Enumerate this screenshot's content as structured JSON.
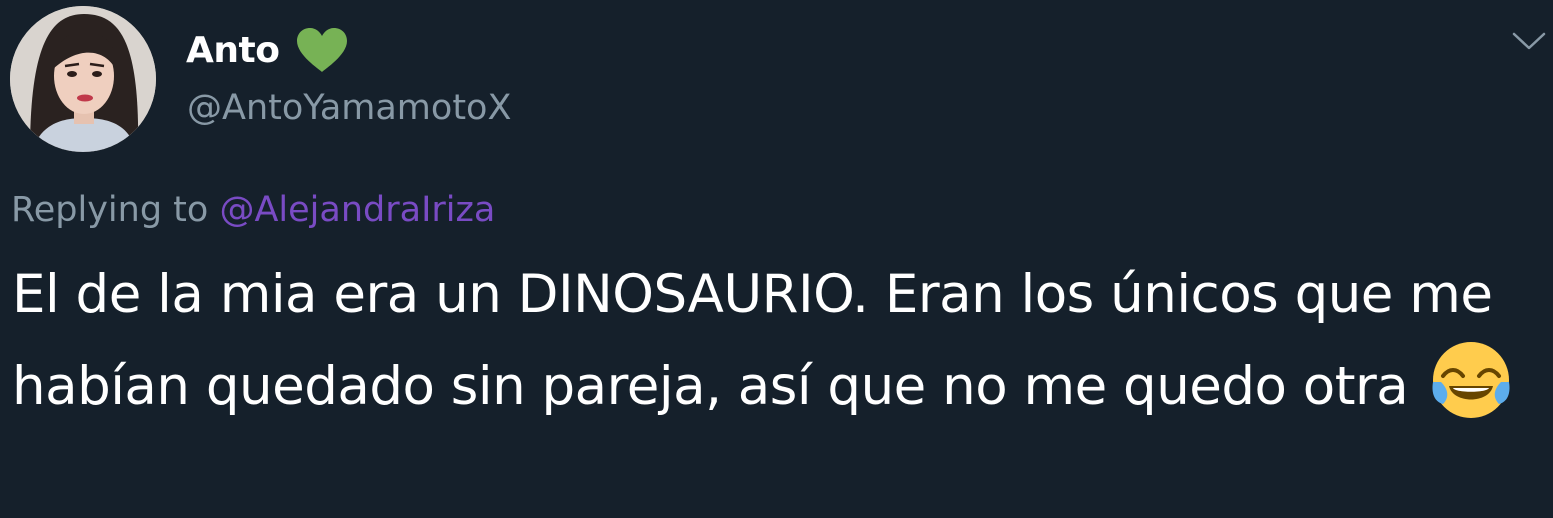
{
  "tweet": {
    "author": {
      "display_name": "Anto",
      "handle": "@AntoYamamotoX",
      "name_badge_icon": "green-heart-icon"
    },
    "menu_icon": "chevron-down-icon",
    "reply_context": {
      "prefix": "Replying to",
      "mention": "@AlejandraIriza"
    },
    "text": "El de la mia era un DINOSAURIO. Eran los únicos que me habían quedado sin pareja, así que no me quedo otra",
    "trailing_emoji": "face-with-tears-of-joy-icon"
  },
  "colors": {
    "background": "#15202b",
    "primary_text": "#ffffff",
    "secondary_text": "#8899a6",
    "mention_link": "#794bc4",
    "heart": "#77b255"
  }
}
